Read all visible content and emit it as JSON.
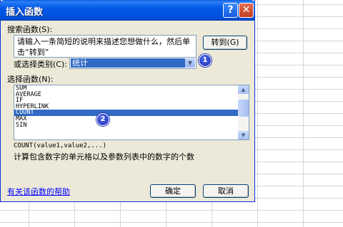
{
  "dialog": {
    "title": "插入函数",
    "help_button": "?",
    "close_button": "✕"
  },
  "search": {
    "label": "搜索函数",
    "label_key": "(S):",
    "value": "请输入一条简短的说明来描述您想做什么，然后单击“转到”",
    "go_button": "转到(G)"
  },
  "category": {
    "label": "或选择类别",
    "label_key": "(C):",
    "value": "统计",
    "badge": "1"
  },
  "function_list": {
    "label": "选择函数",
    "label_key": "(N):",
    "items": [
      "SUM",
      "AVERAGE",
      "IF",
      "HYPERLINK",
      "COUNT",
      "MAX",
      "SIN"
    ],
    "selected": "COUNT",
    "badge": "2"
  },
  "syntax": "COUNT(value1,value2,...)",
  "function_description": "计算包含数字的单元格以及参数列表中的数字的个数",
  "help_link": "有关该函数的帮助",
  "buttons": {
    "ok": "确定",
    "cancel": "取消"
  },
  "colors": {
    "title_bar": "#0058e6",
    "dialog_bg": "#ece9d8",
    "selection": "#316ac5",
    "badge": "#1c2fb5"
  }
}
